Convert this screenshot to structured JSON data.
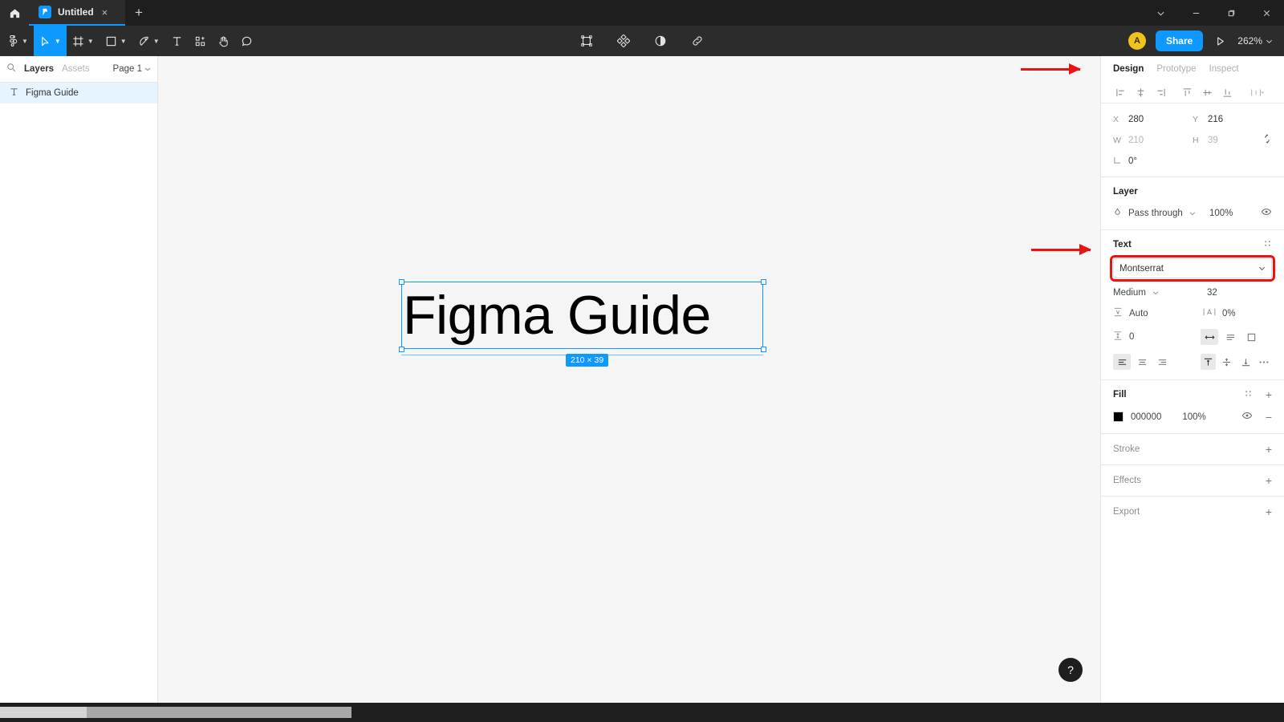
{
  "titlebar": {
    "home_icon": "home-icon",
    "tab": {
      "label": "Untitled",
      "icon": "figma-file-icon",
      "close": "×"
    },
    "new_tab": "+",
    "window": {
      "chevron": "⌄",
      "minimize": "—",
      "maximize": "❐",
      "close": "✕"
    }
  },
  "toolbar": {
    "left_tools": [
      {
        "name": "figma-menu-icon",
        "caret": true
      },
      {
        "name": "move-tool-icon",
        "caret": true,
        "active": true
      },
      {
        "name": "frame-tool-icon",
        "caret": true
      },
      {
        "name": "shape-tool-icon",
        "caret": true
      },
      {
        "name": "pen-tool-icon",
        "caret": true
      },
      {
        "name": "text-tool-icon",
        "caret": false
      },
      {
        "name": "components-tool-icon",
        "caret": false
      },
      {
        "name": "hand-tool-icon",
        "caret": false
      },
      {
        "name": "comment-tool-icon",
        "caret": false
      }
    ],
    "center_tools": [
      {
        "name": "selection-bounds-icon"
      },
      {
        "name": "plugins-icon"
      },
      {
        "name": "contrast-icon"
      },
      {
        "name": "link-icon"
      }
    ],
    "avatar_initial": "A",
    "share_label": "Share",
    "present_icon": "play-icon",
    "zoom_level": "262%",
    "zoom_caret": "⌄"
  },
  "left_panel": {
    "search_icon": "search-icon",
    "tabs": [
      {
        "label": "Layers",
        "active": true
      },
      {
        "label": "Assets",
        "active": false
      }
    ],
    "page_selector": {
      "label": "Page 1",
      "caret": "⌄"
    },
    "layers": [
      {
        "icon": "text-layer-icon",
        "name": "Figma Guide",
        "selected": true
      }
    ]
  },
  "canvas": {
    "text_content": "Figma Guide",
    "size_badge": "210 × 39",
    "help_label": "?"
  },
  "right_panel": {
    "tabs": [
      {
        "label": "Design",
        "active": true
      },
      {
        "label": "Prototype",
        "active": false
      },
      {
        "label": "Inspect",
        "active": false
      }
    ],
    "align_tools": [
      "align-left-icon",
      "align-horizontal-center-icon",
      "align-right-icon",
      "align-top-icon",
      "align-vertical-center-icon",
      "align-bottom-icon",
      "distribute-icon"
    ],
    "transform": {
      "x_label": "X",
      "x_value": "280",
      "y_label": "Y",
      "y_value": "216",
      "w_label": "W",
      "w_value": "210",
      "h_label": "H",
      "h_value": "39",
      "rotation_label": "rotation-icon",
      "rotation_value": "0°",
      "constrain_icon": "constrain-proportions-icon"
    },
    "layer_section": {
      "title": "Layer",
      "blend_mode": "Pass through",
      "blend_caret": "⌄",
      "opacity": "100%",
      "visibility_icon": "eye-icon"
    },
    "text_section": {
      "title": "Text",
      "settings_icon": "text-settings-icon",
      "font_family": "Montserrat",
      "font_family_caret": "⌄",
      "font_weight": "Medium",
      "font_weight_caret": "⌄",
      "font_size": "32",
      "line_height_label": "Auto",
      "line_height_icon": "line-height-icon",
      "letter_spacing_label": "0%",
      "letter_spacing_icon": "letter-spacing-icon",
      "paragraph_spacing": "0",
      "paragraph_spacing_icon": "paragraph-spacing-icon",
      "resize_icons": [
        "auto-width-icon",
        "auto-height-icon",
        "fixed-size-icon"
      ],
      "align_h_icons": [
        "text-align-left-icon",
        "text-align-center-icon",
        "text-align-right-icon"
      ],
      "align_v_icons": [
        "text-align-top-icon",
        "text-align-middle-icon",
        "text-align-bottom-icon"
      ],
      "more_icon": "more-options-icon"
    },
    "fill_section": {
      "title": "Fill",
      "style_icon": "style-picker-icon",
      "add_icon": "+",
      "color_hex": "000000",
      "color_value": "#000000",
      "opacity": "100%",
      "visibility_icon": "eye-icon",
      "remove_icon": "−"
    },
    "stroke_section": {
      "title": "Stroke",
      "add_icon": "+"
    },
    "effects_section": {
      "title": "Effects",
      "add_icon": "+"
    },
    "export_section": {
      "title": "Export",
      "add_icon": "+"
    }
  },
  "annotations": {
    "accent_color": "#e81313",
    "arrow_design_tab": "arrow-pointing-to-design-tab",
    "arrow_text_section": "arrow-pointing-to-text-section",
    "highlight_font_field": "highlight-box-font-family"
  }
}
